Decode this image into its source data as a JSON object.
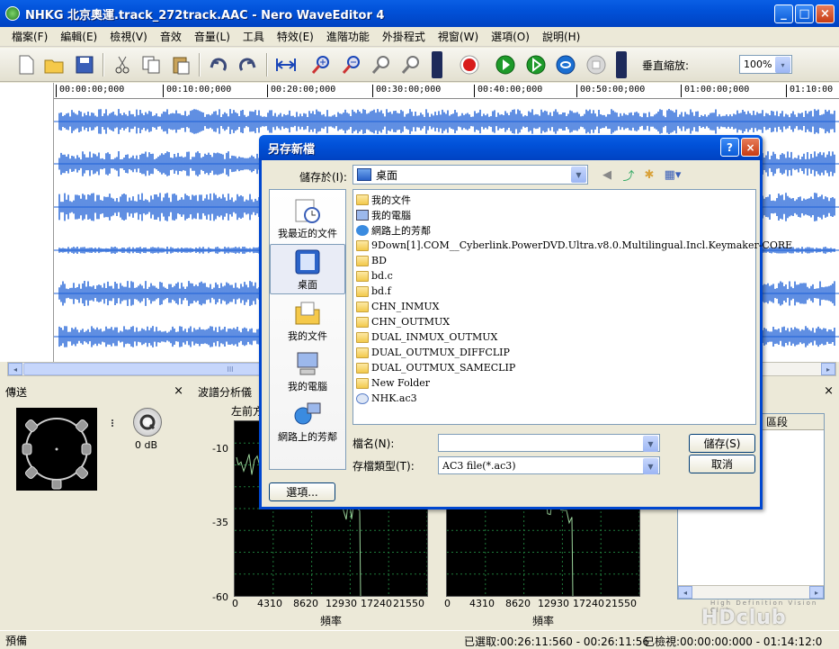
{
  "window": {
    "title": "NHKG 北京奧運.track_272track.AAC - Nero WaveEditor 4",
    "minimize": "_",
    "maximize": "□",
    "close": "×"
  },
  "menu": [
    "檔案(F)",
    "編輯(E)",
    "檢視(V)",
    "音效",
    "音量(L)",
    "工具",
    "特效(E)",
    "進階功能",
    "外掛程式",
    "視窗(W)",
    "選項(O)",
    "說明(H)"
  ],
  "toolbar": {
    "zoom_label": "垂直縮放:",
    "zoom_value": "100%",
    "zoom_arrow": "▾"
  },
  "timeline": [
    "00:00:00;000",
    "00:10:00;000",
    "00:20:00;000",
    "00:30:00;000",
    "00:40:00;000",
    "00:50:00;000",
    "01:00:00;000",
    "01:10:00"
  ],
  "scroll": {
    "left": "◂",
    "right": "▸",
    "thumb": "III"
  },
  "panels": {
    "transfer_title": "傳送",
    "transfer_close": "×",
    "volume_db": "0 dB",
    "spectrum_title": "波譜分析儀",
    "spectrum_close": "×",
    "channel_label": "左前方",
    "segment_title": "區段",
    "y_ticks": [
      "-10",
      "-35",
      "-60"
    ],
    "x_ticks": [
      "0",
      "4310",
      "8620",
      "12930",
      "17240",
      "21550"
    ],
    "x_axis_title": "頻率"
  },
  "status": {
    "ready": "預備",
    "selection": "已選取:00:26:11:560 - 00:26:11:56",
    "view": "已檢視:00:00:00:000 - 01:14:12:0"
  },
  "watermark": {
    "main": "HDclub",
    "sub": "High Definition Vision Club"
  },
  "dialog": {
    "title": "另存新檔",
    "help": "?",
    "close": "×",
    "save_in_label": "儲存於(I):",
    "save_in_value": "桌面",
    "places": [
      "我最近的文件",
      "桌面",
      "我的文件",
      "我的電腦",
      "網路上的芳鄰"
    ],
    "files": [
      "我的文件",
      "我的電腦",
      "網路上的芳鄰",
      "9Down[1].COM__Cyberlink.PowerDVD.Ultra.v8.0.Multilingual.Incl.Keymaker-CORE",
      "BD",
      "bd.c",
      "bd.f",
      "CHN_INMUX",
      "CHN_OUTMUX",
      "DUAL_INMUX_OUTMUX",
      "DUAL_OUTMUX_DIFFCLIP",
      "DUAL_OUTMUX_SAMECLIP",
      "New Folder",
      "NHK.ac3"
    ],
    "filename_label": "檔名(N):",
    "filename_value": "",
    "filetype_label": "存檔類型(T):",
    "filetype_value": "AC3 file(*.ac3)",
    "save_button": "儲存(S)",
    "cancel_button": "取消",
    "options_button": "選項..."
  },
  "colors": {
    "waveform": "#1c5fd6",
    "spectrum_line": "#9ad39a",
    "grid": "#1e7a3a",
    "xp_blue": "#0a5fe5"
  }
}
